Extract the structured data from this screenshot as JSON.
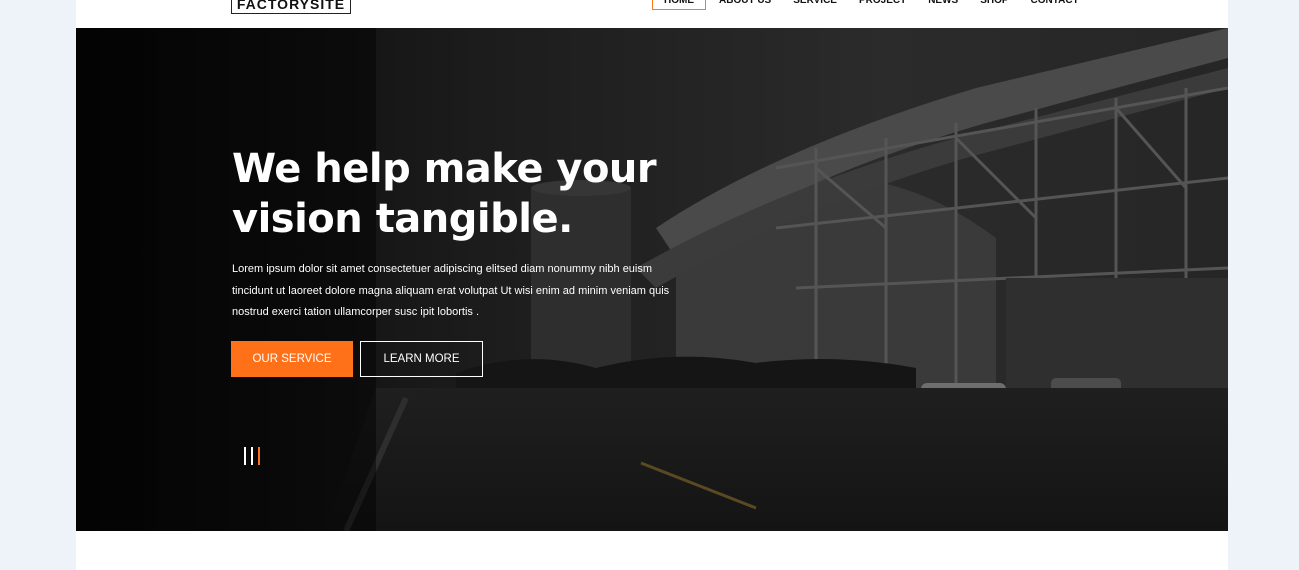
{
  "header": {
    "logo_text": "FACTORYSITE",
    "nav": [
      {
        "label": "HOME",
        "active": true
      },
      {
        "label": "ABOUT US",
        "active": false
      },
      {
        "label": "SERVICE",
        "active": false
      },
      {
        "label": "PROJECT",
        "active": false
      },
      {
        "label": "NEWS",
        "active": false
      },
      {
        "label": "SHOP",
        "active": false
      },
      {
        "label": "CONTACT",
        "active": false
      }
    ]
  },
  "hero": {
    "headline_line1": "We help make your",
    "headline_line2": "vision tangible.",
    "body": "Lorem ipsum dolor sit amet consectetuer adipiscing elitsed diam nonummy nibh euism tincidunt ut laoreet dolore magna aliquam erat volutpat Ut wisi enim ad minim veniam quis nostrud exerci tation ullamcorper susc ipit lobortis .",
    "primary_button": "OUR SERVICE",
    "secondary_button": "LEARN MORE",
    "slides_total": 3,
    "active_slide": 3
  },
  "colors": {
    "accent": "#ff7119",
    "page_background": "#eef3fa",
    "hero_overlay": "#1b1b1b"
  }
}
